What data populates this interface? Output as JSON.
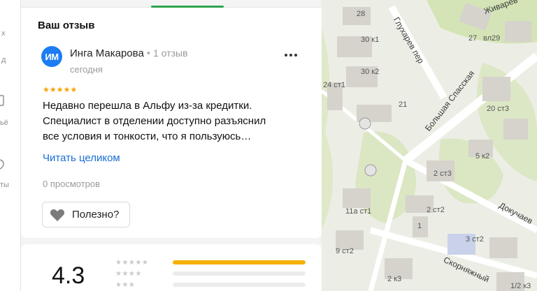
{
  "sidebar": {
    "partial_labels": [
      "х",
      "д",
      "ьё",
      "ты"
    ]
  },
  "review_section": {
    "title": "Ваш отзыв",
    "author": {
      "initials": "ИМ",
      "name": "Инга Макарова",
      "separator": "•",
      "reviews_count": "1 отзыв",
      "date": "сегодня",
      "avatar_color": "#1d7cf2"
    },
    "rating_stars": 5,
    "text_lines": [
      "Недавно перешла в Альфу из-за кредитки.",
      "Специалист в отделении доступно разъяснил",
      "все условия и тонкости, что я пользуюсь…"
    ],
    "read_more": "Читать целиком",
    "views": "0 просмотров",
    "useful_button": "Полезно?",
    "more_icon": "more-dots-icon"
  },
  "rating_summary": {
    "score": "4.3",
    "distribution": [
      {
        "stars": 5,
        "fraction": 1.0
      },
      {
        "stars": 4,
        "fraction": 0.0
      },
      {
        "stars": 3,
        "fraction": 0.0
      }
    ],
    "bar_color": "#f5b000"
  },
  "map": {
    "streets": [
      "Глухарев пер",
      "Живарев",
      "Большая Спасская",
      "Докучаев",
      "Скорняжный"
    ],
    "labels": [
      "28",
      "30 к1",
      "27",
      "вл29",
      "30 к2",
      "24 ст1",
      "21",
      "20 ст3",
      "5 к2",
      "2 ст3",
      "2 ст2",
      "11а ст1",
      "9 ст2",
      "1",
      "3 ст2",
      "2 к3",
      "1/2 к3"
    ]
  }
}
